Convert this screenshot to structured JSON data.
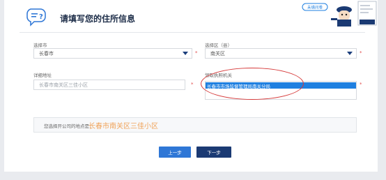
{
  "page": {
    "title": "请填写您的住所信息"
  },
  "badge": {
    "text": "未填问卷"
  },
  "city": {
    "label": "选择市",
    "value": "长春市"
  },
  "district": {
    "label": "选择区（县）",
    "value": "南关区"
  },
  "address": {
    "label": "详细地址",
    "placeholder": "长春市南关区三佳小区"
  },
  "authority": {
    "label": "领取执照机关",
    "selected": "长春市市场监督管理局南关分局"
  },
  "result": {
    "label": "您选择开公司的地点是：",
    "value": "长春市南关区三佳小区"
  },
  "buttons": {
    "prev": "上一步",
    "next": "下一步"
  },
  "colors": {
    "accent": "#2f77d6",
    "dark": "#1b3a73",
    "highlight": "#d63a3a",
    "orange": "#f0a35a"
  }
}
